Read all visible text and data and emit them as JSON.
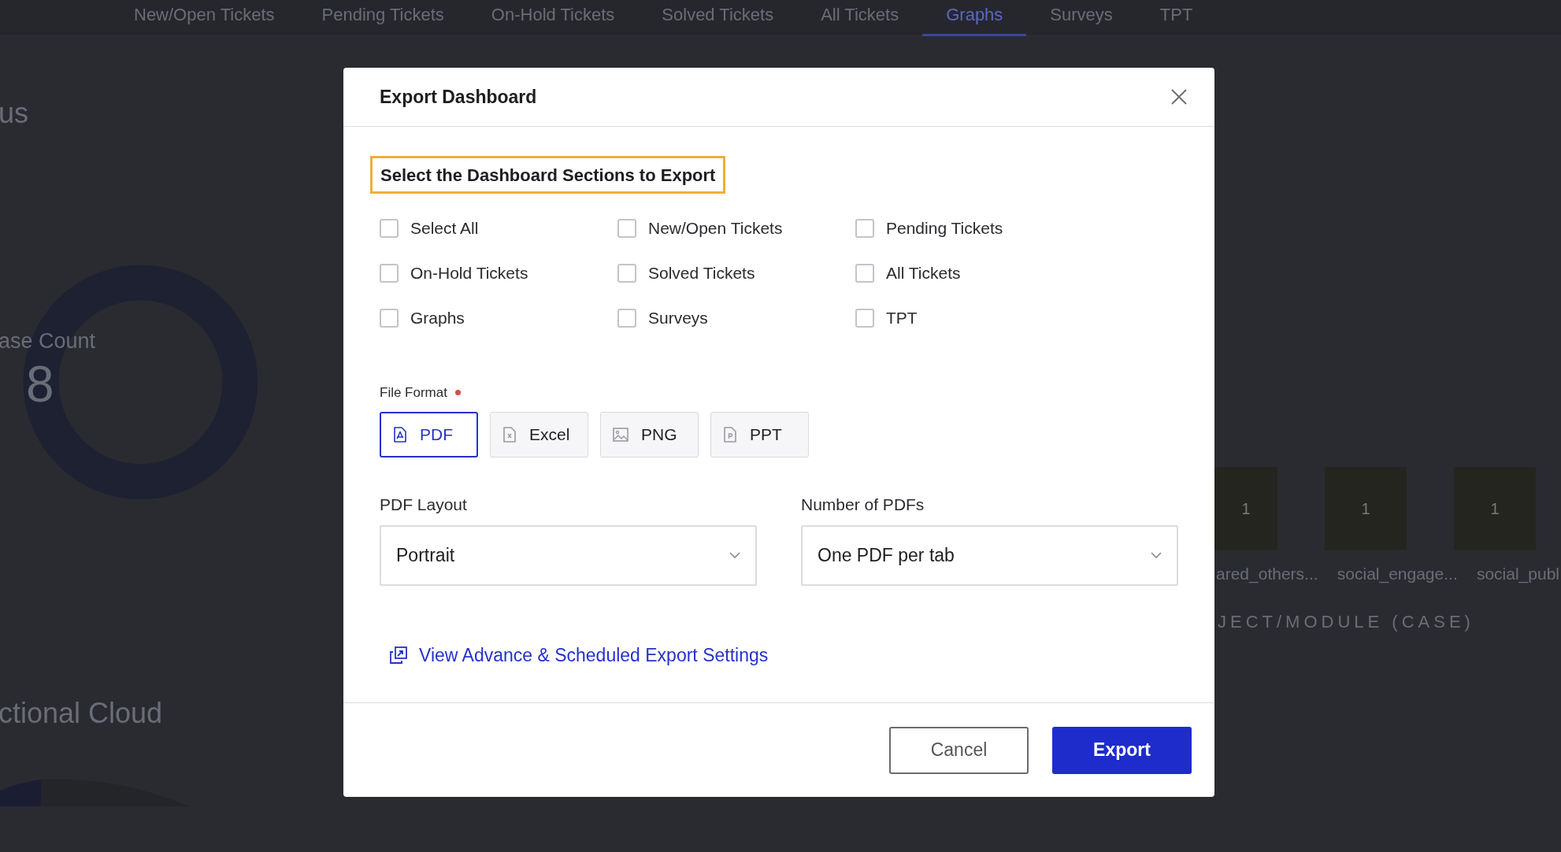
{
  "nav_tabs": [
    {
      "label": "New/Open Tickets",
      "selected": false
    },
    {
      "label": "Pending Tickets",
      "selected": false
    },
    {
      "label": "On-Hold Tickets",
      "selected": false
    },
    {
      "label": "Solved Tickets",
      "selected": false
    },
    {
      "label": "All Tickets",
      "selected": false
    },
    {
      "label": "Graphs",
      "selected": true
    },
    {
      "label": "Surveys",
      "selected": false
    },
    {
      "label": "TPT",
      "selected": false
    }
  ],
  "background": {
    "left_title": "us",
    "donut_label": "ase Count",
    "donut_value": "8",
    "lower_title": "ctional Cloud",
    "bars": [
      {
        "value": "1",
        "label": "ared_others..."
      },
      {
        "value": "1",
        "label": "social_engage..."
      },
      {
        "value": "1",
        "label": "social_publ"
      }
    ],
    "axis_title": "JECT/MODULE (CASE)"
  },
  "dialog": {
    "title": "Export Dashboard",
    "section_heading": "Select the Dashboard Sections to Export",
    "sections": [
      {
        "label": "Select All",
        "checked": false
      },
      {
        "label": "New/Open Tickets",
        "checked": false
      },
      {
        "label": "Pending Tickets",
        "checked": false
      },
      {
        "label": "On-Hold Tickets",
        "checked": false
      },
      {
        "label": "Solved Tickets",
        "checked": false
      },
      {
        "label": "All Tickets",
        "checked": false
      },
      {
        "label": "Graphs",
        "checked": false
      },
      {
        "label": "Surveys",
        "checked": false
      },
      {
        "label": "TPT",
        "checked": false
      }
    ],
    "file_format_label": "File Format",
    "file_format_required": true,
    "formats": [
      {
        "kind": "pdf",
        "label": "PDF",
        "selected": true
      },
      {
        "kind": "excel",
        "label": "Excel",
        "selected": false
      },
      {
        "kind": "image",
        "label": "PNG",
        "selected": false
      },
      {
        "kind": "ppt",
        "label": "PPT",
        "selected": false
      }
    ],
    "pdf_layout": {
      "label": "PDF Layout",
      "value": "Portrait"
    },
    "number_of_pdfs": {
      "label": "Number of PDFs",
      "value": "One PDF per tab"
    },
    "link": "View Advance & Scheduled Export Settings",
    "buttons": {
      "cancel": "Cancel",
      "export": "Export"
    }
  }
}
